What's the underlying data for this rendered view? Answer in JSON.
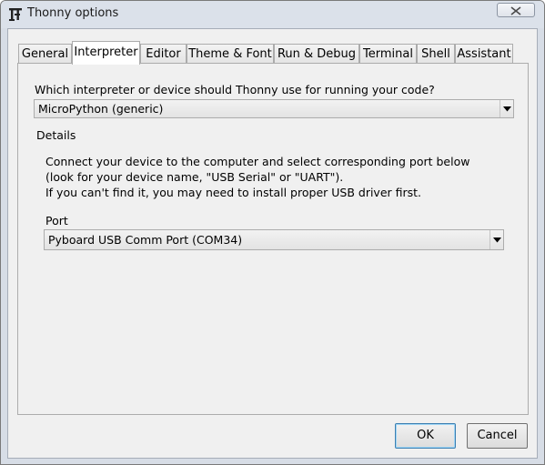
{
  "window": {
    "title": "Thonny options"
  },
  "tabs": [
    {
      "label": "General"
    },
    {
      "label": "Interpreter"
    },
    {
      "label": "Editor"
    },
    {
      "label": "Theme & Font"
    },
    {
      "label": "Run & Debug"
    },
    {
      "label": "Terminal"
    },
    {
      "label": "Shell"
    },
    {
      "label": "Assistant"
    }
  ],
  "active_tab": "Interpreter",
  "interpreter": {
    "question": "Which interpreter or device should Thonny use for running your code?",
    "selected_interpreter": "MicroPython (generic)",
    "details_label": "Details",
    "instructions": [
      "Connect your device to the computer and select corresponding port below",
      "(look for your device name, \"USB Serial\" or \"UART\").",
      "If you can't find it, you may need to install proper USB driver first."
    ],
    "port_label": "Port",
    "selected_port": "Pyboard USB Comm Port (COM34)"
  },
  "buttons": {
    "ok": "OK",
    "cancel": "Cancel"
  },
  "icons": {
    "app": "thonny-app-icon",
    "close": "close-icon",
    "dropdown": "chevron-down-icon"
  }
}
